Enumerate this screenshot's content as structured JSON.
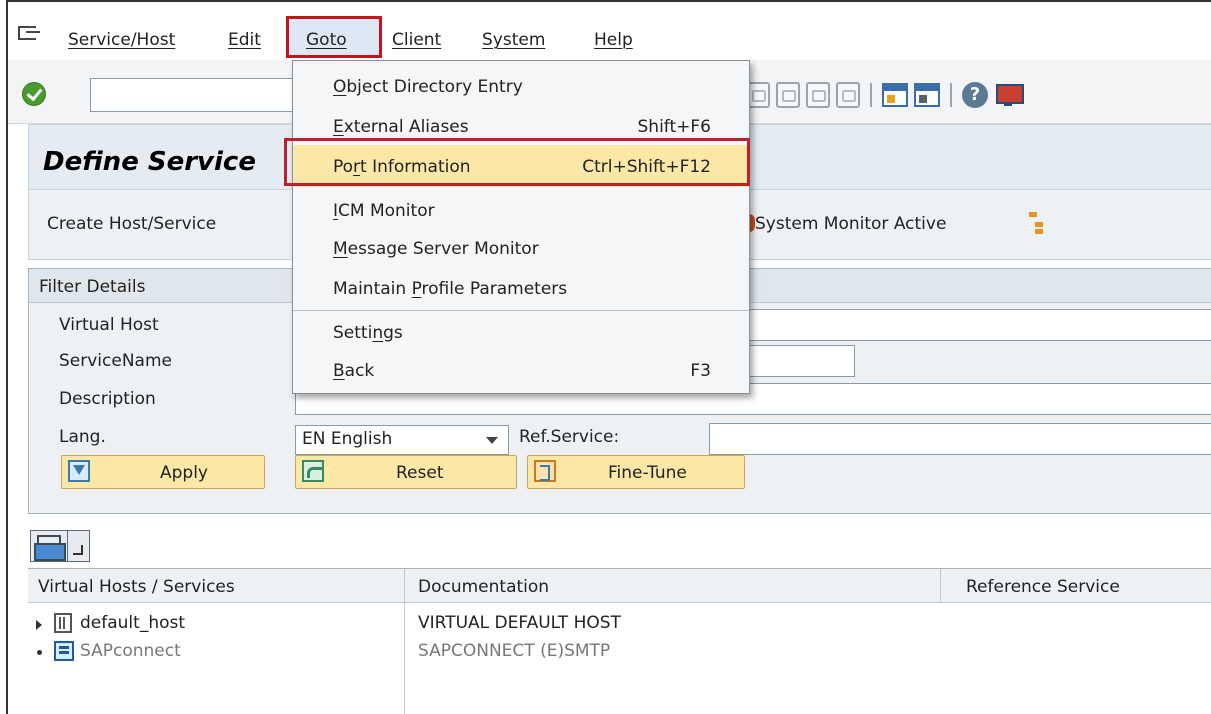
{
  "menubar": {
    "items": [
      {
        "label": "Service/Host"
      },
      {
        "label": "Edit"
      },
      {
        "label": "Goto"
      },
      {
        "label": "Client"
      },
      {
        "label": "System"
      },
      {
        "label": "Help"
      }
    ]
  },
  "page_title": "Define Service",
  "app_toolbar": {
    "create": "Create Host/Service",
    "system_monitor": "System Monitor Active"
  },
  "filter": {
    "title": "Filter Details",
    "virtual_host_label": "Virtual Host",
    "service_name_label": "ServiceName",
    "description_label": "Description",
    "lang_label": "Lang.",
    "lang_value": "EN English",
    "ref_service_label": "Ref.Service:",
    "apply": "Apply",
    "reset": "Reset",
    "fine_tune": "Fine-Tune"
  },
  "table": {
    "columns": [
      "Virtual Hosts / Services",
      "Documentation",
      "Reference Service"
    ],
    "rows": [
      {
        "name": "default_host",
        "doc": "VIRTUAL DEFAULT HOST",
        "ref": ""
      },
      {
        "name": "SAPconnect",
        "doc": "SAPCONNECT (E)SMTP",
        "ref": ""
      }
    ]
  },
  "goto_menu": {
    "items": [
      {
        "label_pre": "",
        "label_acc": "O",
        "label_post": "bject Directory Entry",
        "shortcut": ""
      },
      {
        "label_pre": "",
        "label_acc": "E",
        "label_post": "xternal Aliases",
        "shortcut": "Shift+F6"
      },
      {
        "label_pre": "Po",
        "label_acc": "r",
        "label_post": "t Information",
        "shortcut": "Ctrl+Shift+F12"
      },
      {
        "label_pre": "",
        "label_acc": "I",
        "label_post": "CM Monitor",
        "shortcut": ""
      },
      {
        "label_pre": "",
        "label_acc": "M",
        "label_post": "essage Server Monitor",
        "shortcut": ""
      },
      {
        "label_pre": "Maintain ",
        "label_acc": "P",
        "label_post": "rofile Parameters",
        "shortcut": ""
      },
      {
        "label_pre": "Setti",
        "label_acc": "n",
        "label_post": "gs",
        "shortcut": ""
      },
      {
        "label_pre": "",
        "label_acc": "B",
        "label_post": "ack",
        "shortcut": "F3"
      }
    ]
  },
  "colors": {
    "highlight": "#fbe8a6",
    "annotation_red": "#c4151c",
    "title_bg": "#e4ebf1"
  }
}
